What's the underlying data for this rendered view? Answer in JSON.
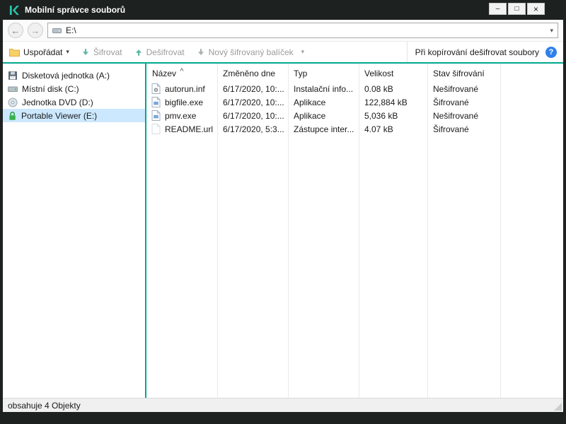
{
  "window": {
    "title": "Mobilní správce souborů"
  },
  "titlebar_buttons": {
    "minimize": "–",
    "maximize": "□",
    "close": "×"
  },
  "nav": {
    "back": "←",
    "forward": "→",
    "address": "E:\\",
    "dropdown": "▾"
  },
  "toolbar": {
    "organize": "Uspořádat",
    "organize_caret": "▾",
    "encrypt": "Šifrovat",
    "decrypt": "Dešifrovat",
    "new_package": "Nový šifrovaný balíček",
    "package_caret": "▾",
    "decrypt_on_copy": "Při kopírování dešifrovat soubory",
    "help": "?"
  },
  "sidebar": {
    "items": [
      {
        "label": "Disketová jednotka (A:)",
        "icon": "floppy-icon",
        "selected": false
      },
      {
        "label": "Místní disk (C:)",
        "icon": "hdd-icon",
        "selected": false
      },
      {
        "label": "Jednotka DVD (D:)",
        "icon": "dvd-icon",
        "selected": false
      },
      {
        "label": "Portable Viewer (E:)",
        "icon": "lock-icon",
        "selected": true
      }
    ]
  },
  "filelist": {
    "sort_indicator": "^",
    "columns": {
      "name": "Název",
      "modified": "Změněno dne",
      "type": "Typ",
      "size": "Velikost",
      "status": "Stav šifrování"
    },
    "rows": [
      {
        "name": "autorun.inf",
        "modified": "6/17/2020, 10:...",
        "type": "Instalační info...",
        "size": "0.08 kB",
        "status": "Nešifrované"
      },
      {
        "name": "bigfile.exe",
        "modified": "6/17/2020, 10:...",
        "type": "Aplikace",
        "size": "122,884 kB",
        "status": "Šifrované"
      },
      {
        "name": "pmv.exe",
        "modified": "6/17/2020, 10:...",
        "type": "Aplikace",
        "size": "5,036 kB",
        "status": "Nešifrované"
      },
      {
        "name": "README.url",
        "modified": "6/17/2020, 5:3...",
        "type": "Zástupce inter...",
        "size": "4.07 kB",
        "status": "Šifrované"
      }
    ]
  },
  "statusbar": {
    "text": "obsahuje 4 Objekty"
  },
  "colors": {
    "accent_teal": "#00a88e",
    "selection_blue": "#cce8ff",
    "help_blue": "#2f80ed",
    "titlebar_dark": "#1d211f"
  }
}
